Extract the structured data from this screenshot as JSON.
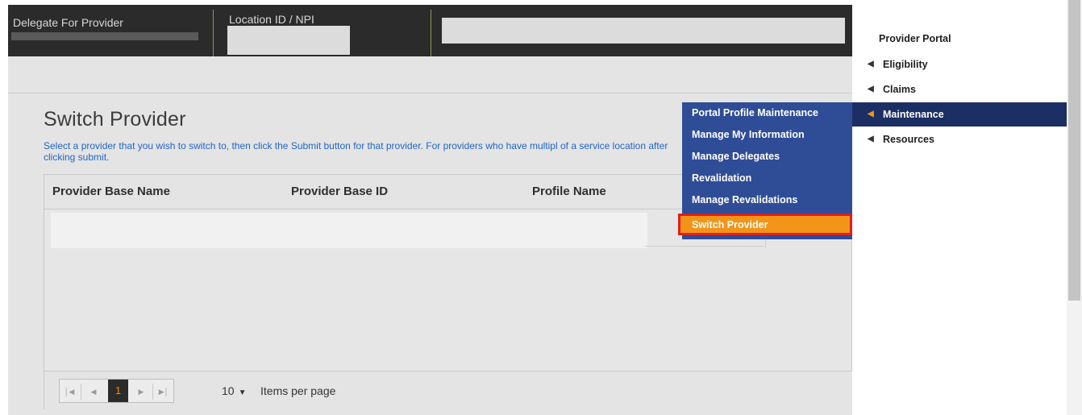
{
  "header": {
    "delegate_label": "Delegate For Provider",
    "location_label": "Location ID / NPI"
  },
  "page": {
    "title": "Switch Provider",
    "instructions": "Select a provider that you wish to switch to, then click the Submit button for that provider. For providers who have multipl of a service location after clicking submit."
  },
  "grid": {
    "columns": [
      "Provider Base Name",
      "Provider Base ID",
      "Profile Name"
    ]
  },
  "pager": {
    "current_page": "1",
    "per_page_value": "10",
    "per_page_label": "Items per page"
  },
  "submenu": {
    "items": [
      {
        "label": "Portal Profile Maintenance"
      },
      {
        "label": "Manage My Information"
      },
      {
        "label": "Manage Delegates"
      },
      {
        "label": "Revalidation"
      },
      {
        "label": "Manage Revalidations"
      },
      {
        "label": "Switch Provider"
      }
    ],
    "active_index": 5
  },
  "nav": {
    "title": "Provider Portal",
    "items": [
      {
        "label": "Eligibility"
      },
      {
        "label": "Claims"
      },
      {
        "label": "Maintenance"
      },
      {
        "label": "Resources"
      }
    ],
    "active_index": 2
  },
  "colors": {
    "submenu_bg": "#2f4c97",
    "active_nav_bg": "#1c2f64",
    "highlight_orange": "#f29418",
    "highlight_border": "#e01e1e",
    "instruction_blue": "#2266c5"
  },
  "icons": {
    "nav_arrow": "caret-left-icon",
    "first_page": "first-page-icon",
    "prev_page": "prev-page-icon",
    "next_page": "next-page-icon",
    "last_page": "last-page-icon",
    "dropdown": "caret-down-icon"
  }
}
